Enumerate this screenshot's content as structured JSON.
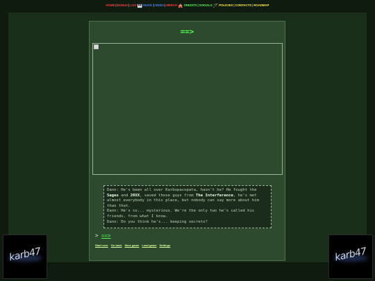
{
  "nav": {
    "items": [
      {
        "label": "HOME",
        "color": "#ff3b3b"
      },
      {
        "label": "BONUS",
        "color": "#ff3b3b"
      },
      {
        "label": "LOG",
        "color": "#ff3b3b"
      },
      {
        "label": "MUSIC",
        "color": "#4c7dff",
        "icon": "🎹"
      },
      {
        "label": "NEWS",
        "color": "#4c7dff"
      },
      {
        "label": "MERCH",
        "color": "#ff3b3b"
      },
      {
        "label": "CREDITS",
        "color": "#4cff4c",
        "icon": "🎪"
      },
      {
        "label": "SOCIALS",
        "color": "#4cff4c"
      },
      {
        "label": "POLICIES",
        "color": "#ffee33",
        "icon": "🪄"
      },
      {
        "label": "CONTACTS",
        "color": "#ffee33"
      },
      {
        "label": "ROADMAP",
        "color": "#ffee33"
      }
    ]
  },
  "page": {
    "title": "==>",
    "log_lines": [
      {
        "speaker": "Dann:",
        "parts": [
          {
            "t": "He's been all over Karbopacopata, hasn't he? He fought the "
          },
          {
            "b": "Sages"
          },
          {
            "t": " and "
          },
          {
            "b": "20XX"
          },
          {
            "t": ", saved those guys from "
          },
          {
            "b": "The Interference"
          },
          {
            "t": ", he's met almost everybody in this place, but nobody can say more about him than that."
          }
        ]
      },
      {
        "speaker": "Dann:",
        "parts": [
          {
            "t": "He's so... mysterious. We're the only two he's called his friends, from what I know."
          }
        ]
      },
      {
        "speaker": "Dann:",
        "parts": [
          {
            "t": "Do you think he's... keeping secrets?"
          }
        ]
      }
    ],
    "next_prefix": ">",
    "next_link": "==>"
  },
  "footer": {
    "links": [
      "Start over",
      "Go back",
      "Save game",
      "Load game",
      "Settings"
    ]
  },
  "logo": {
    "text": "karb47"
  }
}
